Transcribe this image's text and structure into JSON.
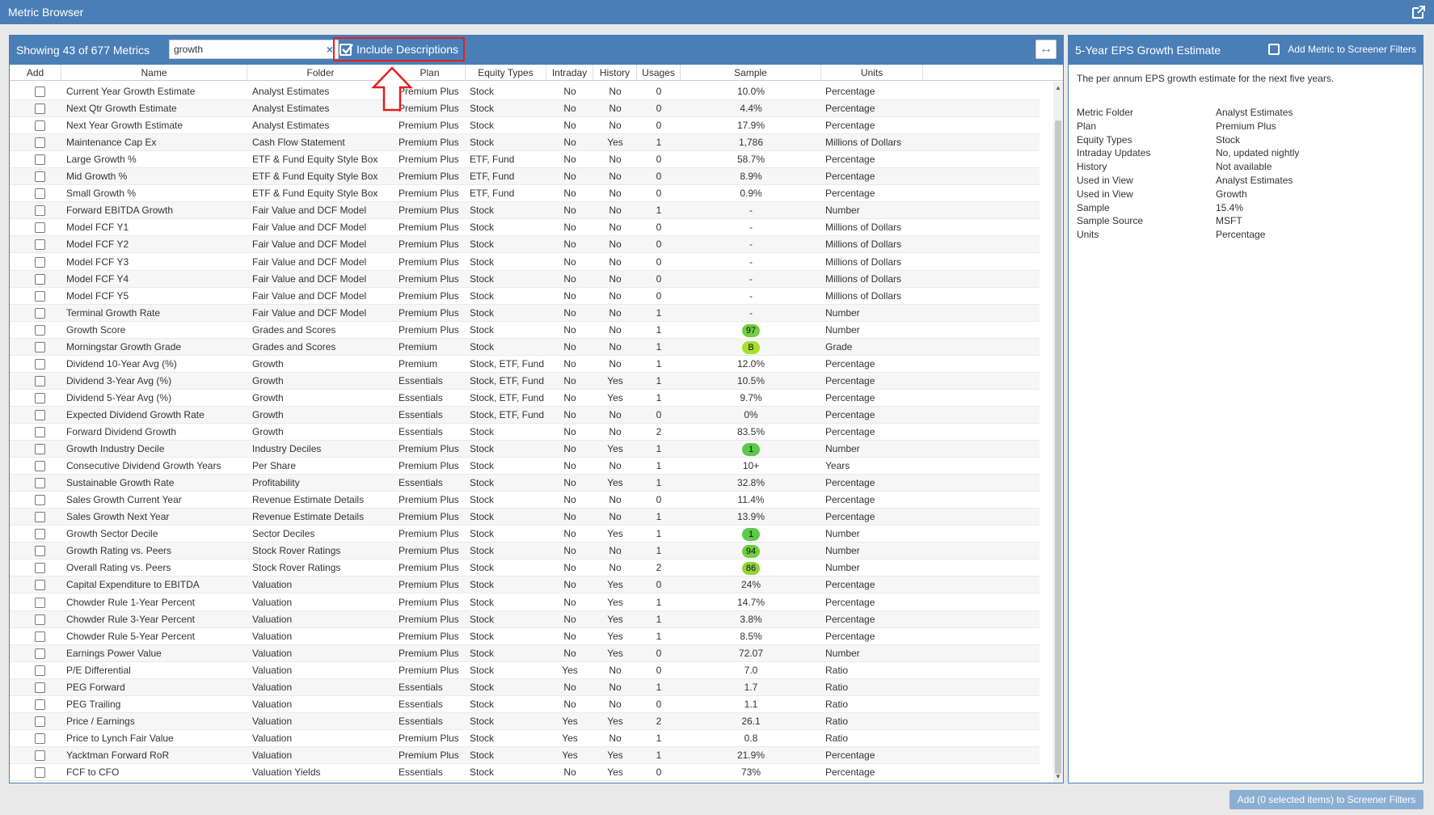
{
  "window": {
    "title": "Metric Browser"
  },
  "toolbar": {
    "count_text": "Showing 43 of 677 Metrics",
    "search_value": "growth",
    "clear_glyph": "×",
    "include_descriptions_label": "Include Descriptions",
    "include_descriptions_checked": true,
    "expand_glyph": "↔"
  },
  "columns": [
    "Add",
    "Name",
    "Folder",
    "Plan",
    "Equity Types",
    "Intraday",
    "History",
    "Usages",
    "Sample",
    "Units"
  ],
  "rows": [
    {
      "name": "Current Year Growth Estimate",
      "folder": "Analyst Estimates",
      "plan": "Premium Plus",
      "equity": "Stock",
      "intraday": "No",
      "history": "No",
      "usages": "0",
      "sample": "10.0%",
      "units": "Percentage"
    },
    {
      "name": "Next Qtr Growth Estimate",
      "folder": "Analyst Estimates",
      "plan": "Premium Plus",
      "equity": "Stock",
      "intraday": "No",
      "history": "No",
      "usages": "0",
      "sample": "4.4%",
      "units": "Percentage"
    },
    {
      "name": "Next Year Growth Estimate",
      "folder": "Analyst Estimates",
      "plan": "Premium Plus",
      "equity": "Stock",
      "intraday": "No",
      "history": "No",
      "usages": "0",
      "sample": "17.9%",
      "units": "Percentage"
    },
    {
      "name": "Maintenance Cap Ex",
      "folder": "Cash Flow Statement",
      "plan": "Premium Plus",
      "equity": "Stock",
      "intraday": "No",
      "history": "Yes",
      "usages": "1",
      "sample": "1,786",
      "units": "Millions of Dollars"
    },
    {
      "name": "Large Growth %",
      "folder": "ETF & Fund Equity Style Box",
      "plan": "Premium Plus",
      "equity": "ETF, Fund",
      "intraday": "No",
      "history": "No",
      "usages": "0",
      "sample": "58.7%",
      "units": "Percentage"
    },
    {
      "name": "Mid Growth %",
      "folder": "ETF & Fund Equity Style Box",
      "plan": "Premium Plus",
      "equity": "ETF, Fund",
      "intraday": "No",
      "history": "No",
      "usages": "0",
      "sample": "8.9%",
      "units": "Percentage"
    },
    {
      "name": "Small Growth %",
      "folder": "ETF & Fund Equity Style Box",
      "plan": "Premium Plus",
      "equity": "ETF, Fund",
      "intraday": "No",
      "history": "No",
      "usages": "0",
      "sample": "0.9%",
      "units": "Percentage"
    },
    {
      "name": "Forward EBITDA Growth",
      "folder": "Fair Value and DCF Model",
      "plan": "Premium Plus",
      "equity": "Stock",
      "intraday": "No",
      "history": "No",
      "usages": "1",
      "sample": "-",
      "units": "Number"
    },
    {
      "name": "Model FCF Y1",
      "folder": "Fair Value and DCF Model",
      "plan": "Premium Plus",
      "equity": "Stock",
      "intraday": "No",
      "history": "No",
      "usages": "0",
      "sample": "-",
      "units": "Millions of Dollars"
    },
    {
      "name": "Model FCF Y2",
      "folder": "Fair Value and DCF Model",
      "plan": "Premium Plus",
      "equity": "Stock",
      "intraday": "No",
      "history": "No",
      "usages": "0",
      "sample": "-",
      "units": "Millions of Dollars"
    },
    {
      "name": "Model FCF Y3",
      "folder": "Fair Value and DCF Model",
      "plan": "Premium Plus",
      "equity": "Stock",
      "intraday": "No",
      "history": "No",
      "usages": "0",
      "sample": "-",
      "units": "Millions of Dollars"
    },
    {
      "name": "Model FCF Y4",
      "folder": "Fair Value and DCF Model",
      "plan": "Premium Plus",
      "equity": "Stock",
      "intraday": "No",
      "history": "No",
      "usages": "0",
      "sample": "-",
      "units": "Millions of Dollars"
    },
    {
      "name": "Model FCF Y5",
      "folder": "Fair Value and DCF Model",
      "plan": "Premium Plus",
      "equity": "Stock",
      "intraday": "No",
      "history": "No",
      "usages": "0",
      "sample": "-",
      "units": "Millions of Dollars"
    },
    {
      "name": "Terminal Growth Rate",
      "folder": "Fair Value and DCF Model",
      "plan": "Premium Plus",
      "equity": "Stock",
      "intraday": "No",
      "history": "No",
      "usages": "1",
      "sample": "-",
      "units": "Number"
    },
    {
      "name": "Growth Score",
      "folder": "Grades and Scores",
      "plan": "Premium Plus",
      "equity": "Stock",
      "intraday": "No",
      "history": "No",
      "usages": "1",
      "sample": "97",
      "sample_pill": "#6fcf3f",
      "units": "Number"
    },
    {
      "name": "Morningstar Growth Grade",
      "folder": "Grades and Scores",
      "plan": "Premium",
      "equity": "Stock",
      "intraday": "No",
      "history": "No",
      "usages": "1",
      "sample": "B",
      "sample_pill": "#a6df2e",
      "units": "Grade"
    },
    {
      "name": "Dividend 10-Year Avg (%)",
      "folder": "Growth",
      "plan": "Premium",
      "equity": "Stock, ETF, Fund",
      "intraday": "No",
      "history": "No",
      "usages": "1",
      "sample": "12.0%",
      "units": "Percentage"
    },
    {
      "name": "Dividend 3-Year Avg (%)",
      "folder": "Growth",
      "plan": "Essentials",
      "equity": "Stock, ETF, Fund",
      "intraday": "No",
      "history": "Yes",
      "usages": "1",
      "sample": "10.5%",
      "units": "Percentage"
    },
    {
      "name": "Dividend 5-Year Avg (%)",
      "folder": "Growth",
      "plan": "Essentials",
      "equity": "Stock, ETF, Fund",
      "intraday": "No",
      "history": "Yes",
      "usages": "1",
      "sample": "9.7%",
      "units": "Percentage"
    },
    {
      "name": "Expected Dividend Growth Rate",
      "folder": "Growth",
      "plan": "Essentials",
      "equity": "Stock, ETF, Fund",
      "intraday": "No",
      "history": "No",
      "usages": "0",
      "sample": "0%",
      "units": "Percentage"
    },
    {
      "name": "Forward Dividend Growth",
      "folder": "Growth",
      "plan": "Essentials",
      "equity": "Stock",
      "intraday": "No",
      "history": "No",
      "usages": "2",
      "sample": "83.5%",
      "units": "Percentage"
    },
    {
      "name": "Growth Industry Decile",
      "folder": "Industry Deciles",
      "plan": "Premium Plus",
      "equity": "Stock",
      "intraday": "No",
      "history": "Yes",
      "usages": "1",
      "sample": "1",
      "sample_pill": "#5cc94a",
      "units": "Number"
    },
    {
      "name": "Consecutive Dividend Growth Years",
      "folder": "Per Share",
      "plan": "Premium Plus",
      "equity": "Stock",
      "intraday": "No",
      "history": "No",
      "usages": "1",
      "sample": "10+",
      "units": "Years"
    },
    {
      "name": "Sustainable Growth Rate",
      "folder": "Profitability",
      "plan": "Essentials",
      "equity": "Stock",
      "intraday": "No",
      "history": "Yes",
      "usages": "1",
      "sample": "32.8%",
      "units": "Percentage"
    },
    {
      "name": "Sales Growth Current Year",
      "folder": "Revenue Estimate Details",
      "plan": "Premium Plus",
      "equity": "Stock",
      "intraday": "No",
      "history": "No",
      "usages": "0",
      "sample": "11.4%",
      "units": "Percentage"
    },
    {
      "name": "Sales Growth Next Year",
      "folder": "Revenue Estimate Details",
      "plan": "Premium Plus",
      "equity": "Stock",
      "intraday": "No",
      "history": "No",
      "usages": "1",
      "sample": "13.9%",
      "units": "Percentage"
    },
    {
      "name": "Growth Sector Decile",
      "folder": "Sector Deciles",
      "plan": "Premium Plus",
      "equity": "Stock",
      "intraday": "No",
      "history": "Yes",
      "usages": "1",
      "sample": "1",
      "sample_pill": "#5cc94a",
      "units": "Number"
    },
    {
      "name": "Growth Rating vs. Peers",
      "folder": "Stock Rover Ratings",
      "plan": "Premium Plus",
      "equity": "Stock",
      "intraday": "No",
      "history": "No",
      "usages": "1",
      "sample": "94",
      "sample_pill": "#6fcf3f",
      "units": "Number"
    },
    {
      "name": "Overall Rating vs. Peers",
      "folder": "Stock Rover Ratings",
      "plan": "Premium Plus",
      "equity": "Stock",
      "intraday": "No",
      "history": "No",
      "usages": "2",
      "sample": "86",
      "sample_pill": "#8fd43a",
      "units": "Number"
    },
    {
      "name": "Capital Expenditure to EBITDA",
      "folder": "Valuation",
      "plan": "Premium Plus",
      "equity": "Stock",
      "intraday": "No",
      "history": "Yes",
      "usages": "0",
      "sample": "24%",
      "units": "Percentage"
    },
    {
      "name": "Chowder Rule 1-Year Percent",
      "folder": "Valuation",
      "plan": "Premium Plus",
      "equity": "Stock",
      "intraday": "No",
      "history": "Yes",
      "usages": "1",
      "sample": "14.7%",
      "units": "Percentage"
    },
    {
      "name": "Chowder Rule 3-Year Percent",
      "folder": "Valuation",
      "plan": "Premium Plus",
      "equity": "Stock",
      "intraday": "No",
      "history": "Yes",
      "usages": "1",
      "sample": "3.8%",
      "units": "Percentage"
    },
    {
      "name": "Chowder Rule 5-Year Percent",
      "folder": "Valuation",
      "plan": "Premium Plus",
      "equity": "Stock",
      "intraday": "No",
      "history": "Yes",
      "usages": "1",
      "sample": "8.5%",
      "units": "Percentage"
    },
    {
      "name": "Earnings Power Value",
      "folder": "Valuation",
      "plan": "Premium Plus",
      "equity": "Stock",
      "intraday": "No",
      "history": "Yes",
      "usages": "0",
      "sample": "72.07",
      "units": "Number"
    },
    {
      "name": "P/E Differential",
      "folder": "Valuation",
      "plan": "Premium Plus",
      "equity": "Stock",
      "intraday": "Yes",
      "history": "No",
      "usages": "0",
      "sample": "7.0",
      "units": "Ratio"
    },
    {
      "name": "PEG Forward",
      "folder": "Valuation",
      "plan": "Essentials",
      "equity": "Stock",
      "intraday": "No",
      "history": "No",
      "usages": "1",
      "sample": "1.7",
      "units": "Ratio"
    },
    {
      "name": "PEG Trailing",
      "folder": "Valuation",
      "plan": "Essentials",
      "equity": "Stock",
      "intraday": "No",
      "history": "No",
      "usages": "0",
      "sample": "1.1",
      "units": "Ratio"
    },
    {
      "name": "Price / Earnings",
      "folder": "Valuation",
      "plan": "Essentials",
      "equity": "Stock",
      "intraday": "Yes",
      "history": "Yes",
      "usages": "2",
      "sample": "26.1",
      "units": "Ratio"
    },
    {
      "name": "Price to Lynch Fair Value",
      "folder": "Valuation",
      "plan": "Premium Plus",
      "equity": "Stock",
      "intraday": "Yes",
      "history": "No",
      "usages": "1",
      "sample": "0.8",
      "units": "Ratio"
    },
    {
      "name": "Yacktman Forward RoR",
      "folder": "Valuation",
      "plan": "Premium Plus",
      "equity": "Stock",
      "intraday": "Yes",
      "history": "Yes",
      "usages": "1",
      "sample": "21.9%",
      "units": "Percentage"
    },
    {
      "name": "FCF to CFO",
      "folder": "Valuation Yields",
      "plan": "Essentials",
      "equity": "Stock",
      "intraday": "No",
      "history": "Yes",
      "usages": "0",
      "sample": "73%",
      "units": "Percentage"
    }
  ],
  "detail": {
    "title": "5-Year EPS Growth Estimate",
    "add_to_filters_label": "Add Metric to Screener Filters",
    "description": "The per annum EPS growth estimate for the next five years.",
    "properties": [
      {
        "key": "Metric Folder",
        "value": "Analyst Estimates"
      },
      {
        "key": "Plan",
        "value": "Premium Plus"
      },
      {
        "key": "Equity Types",
        "value": "Stock"
      },
      {
        "key": "Intraday Updates",
        "value": "No, updated nightly"
      },
      {
        "key": "History",
        "value": "Not available"
      },
      {
        "key": "Used in View",
        "value": "Analyst Estimates"
      },
      {
        "key": "Used in View",
        "value": "Growth"
      },
      {
        "key": "Sample",
        "value": "15.4%"
      },
      {
        "key": "Sample Source",
        "value": "MSFT"
      },
      {
        "key": "Units",
        "value": "Percentage"
      }
    ]
  },
  "footer": {
    "add_button_label": "Add (0 selected items) to Screener Filters"
  },
  "colors": {
    "header_blue": "#4a7eb7",
    "annotation_red": "#e02020"
  }
}
